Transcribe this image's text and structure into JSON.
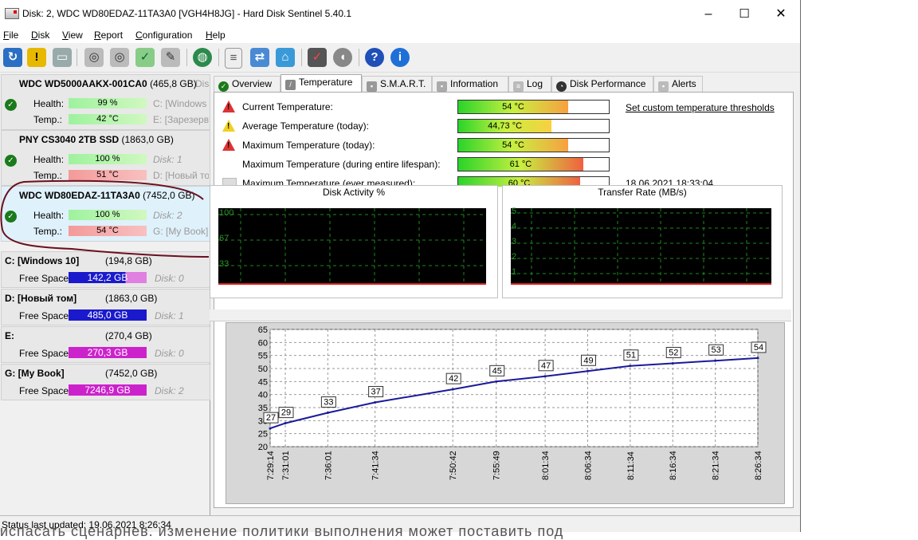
{
  "window": {
    "title": "Disk: 2, WDC WD80EDAZ-11TA3A0 [VGH4H8JG]  -  Hard Disk Sentinel 5.40.1",
    "min": "–",
    "max": "☐",
    "close": "✕"
  },
  "menu": [
    "File",
    "Disk",
    "View",
    "Report",
    "Configuration",
    "Help"
  ],
  "toolbar_icons": [
    "refresh-icon",
    "alert-icon",
    "disk-icon",
    "disk-1-icon",
    "disk-2-icon",
    "disk-check-icon",
    "disk-tools-icon",
    "globe-icon",
    "report-icon",
    "update-icon",
    "network-icon",
    "test-icon",
    "sound-icon",
    "help-icon",
    "info-icon"
  ],
  "disks": [
    {
      "name": "WDC WD5000AAKX-001CA0",
      "size": "(465,8 GB)",
      "tag": "Dis",
      "health": "99 %",
      "temp": "42 °C",
      "vol1": "C: [Windows 1",
      "vol2": "E: [Зарезерв",
      "temp_color": "green"
    },
    {
      "name": "PNY CS3040 2TB SSD",
      "size": "(1863,0 GB)",
      "tag": "",
      "health": "100 %",
      "temp": "51 °C",
      "vol1": "Disk: 1",
      "vol2": "D: [Новый то",
      "temp_color": "red"
    },
    {
      "name": "WDC WD80EDAZ-11TA3A0",
      "size": "(7452,0 GB)",
      "tag": "",
      "health": "100 %",
      "temp": "54 °C",
      "vol1": "Disk: 2",
      "vol2": "G: [My Book]",
      "temp_color": "red"
    }
  ],
  "labels": {
    "health": "Health:",
    "temp": "Temp.:",
    "free": "Free Space"
  },
  "volumes": [
    {
      "name": "C: [Windows 10]",
      "size": "(194,8 GB)",
      "free": "142,2 GB",
      "disk": "Disk: 0",
      "color": "#1a1acc",
      "fill": 0.73
    },
    {
      "name": "D: [Новый том]",
      "size": "(1863,0 GB)",
      "free": "485,0 GB",
      "disk": "Disk: 1",
      "color": "#1a1acc",
      "fill": 0.26
    },
    {
      "name": "E:",
      "size": "(270,4 GB)",
      "free": "270,3 GB",
      "disk": "Disk: 0",
      "color": "#cc22cc",
      "fill": 1.0
    },
    {
      "name": "G: [My Book]",
      "size": "(7452,0 GB)",
      "free": "7246,9 GB",
      "disk": "Disk: 2",
      "color": "#cc22cc",
      "fill": 0.97
    }
  ],
  "tabs": [
    {
      "label": "Overview",
      "icon": "check-icon",
      "active": false
    },
    {
      "label": "Temperature",
      "icon": "thermometer-icon",
      "active": true
    },
    {
      "label": "S.M.A.R.T.",
      "icon": "smart-icon",
      "active": false
    },
    {
      "label": "Information",
      "icon": "info-icon",
      "active": false
    },
    {
      "label": "Log",
      "icon": "log-icon",
      "active": false
    },
    {
      "label": "Disk Performance",
      "icon": "performance-icon",
      "active": false
    },
    {
      "label": "Alerts",
      "icon": "alerts-icon",
      "active": false
    }
  ],
  "temps": [
    {
      "label": "Current Temperature:",
      "value": "54 °C",
      "fill": 0.73,
      "warn": "red"
    },
    {
      "label": "Average Temperature (today):",
      "value": "44,73 °C",
      "fill": 0.62,
      "warn": "yellow"
    },
    {
      "label": "Maximum Temperature (today):",
      "value": "54 °C",
      "fill": 0.73,
      "warn": "red"
    },
    {
      "label": "Maximum Temperature (during entire lifespan):",
      "value": "61 °C",
      "fill": 0.83,
      "warn": "none"
    },
    {
      "label": "Maximum Temperature (ever measured):",
      "value": "60 °C",
      "fill": 0.81,
      "warn": "none"
    }
  ],
  "thresholds_link": "Set custom temperature thresholds",
  "ever_measured_date": "18.06.2021 18:33:04",
  "status": "Status last updated: 19.06.2021 8:26:34",
  "background_text": "испасать сценарнев. изменение политики выполнения может поставить под",
  "chart_data": [
    {
      "type": "line",
      "title": "Disk Activity %",
      "yticks": [
        "100",
        "67",
        "33"
      ],
      "ylim": [
        0,
        100
      ],
      "values": []
    },
    {
      "type": "line",
      "title": "Transfer Rate (MB/s)",
      "yticks": [
        "5",
        "4",
        "3",
        "2",
        "1"
      ],
      "ylim": [
        0,
        5
      ],
      "values": []
    },
    {
      "type": "line",
      "title": "",
      "x": [
        "7:29:14",
        "7:31:01",
        "7:36:01",
        "7:41:34",
        "7:50:42",
        "7:55:49",
        "8:01:34",
        "8:06:34",
        "8:11:34",
        "8:16:34",
        "8:21:34",
        "8:26:34"
      ],
      "x_minutes": [
        0,
        1.78,
        6.78,
        12.33,
        21.47,
        26.58,
        32.33,
        37.33,
        42.33,
        47.33,
        52.33,
        57.33
      ],
      "values": [
        27,
        29,
        33,
        37,
        42,
        45,
        47,
        49,
        51,
        52,
        53,
        54
      ],
      "yticks": [
        20,
        25,
        30,
        35,
        40,
        45,
        50,
        55,
        60,
        65
      ],
      "ylim": [
        20,
        65
      ],
      "grid": true,
      "colors": {
        "line": "#1a1a9a",
        "plot_bg": "#ffffff",
        "area_bg": "#d7d7d7"
      }
    }
  ]
}
